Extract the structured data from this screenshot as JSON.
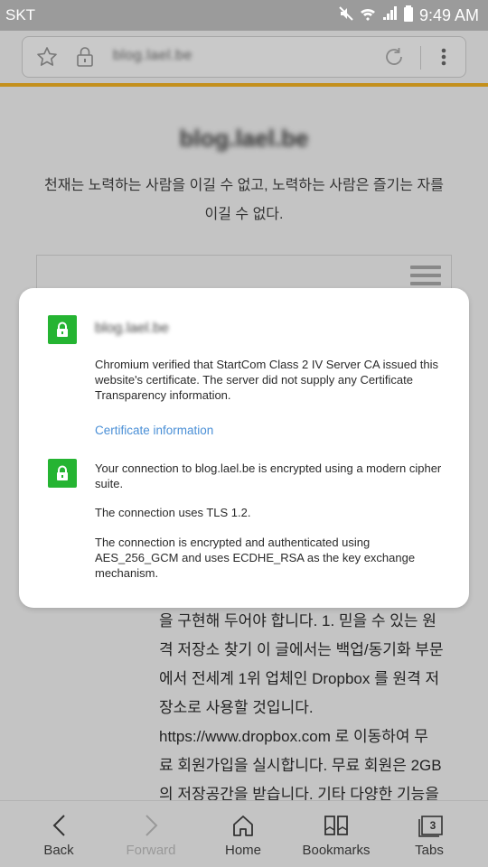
{
  "status_bar": {
    "carrier": "SKT",
    "time": "9:49 AM"
  },
  "address_bar": {
    "url": "blog.lael.be"
  },
  "page": {
    "title": "blog.lael.be",
    "tagline_line1": "천재는 노력하는 사람을 이길 수 없고, 노력하는 사람은 즐기는 자를",
    "tagline_line2": "이길 수 없다.",
    "body_lines": [
      "을 구현해 두어야 합니다.   1. 믿을 수 있는 원",
      "격 저장소 찾기 이 글에서는 백업/동기화 부문",
      "에서 전세계 1위 업체인 Dropbox 를 원격 저",
      "장소로 사용할 것입니다.",
      "https://www.dropbox.com 로 이동하여 무",
      "료 회원가입을 실시합니다. 무료 회원은 2GB",
      "의 저장공간을 받습니다. 기타 다양한 기능을"
    ]
  },
  "dialog": {
    "host": "blog.lael.be",
    "cert_text": "Chromium verified that StartCom Class 2 IV Server CA issued this website's certificate. The server did not supply any Certificate Transparency information.",
    "cert_link": "Certificate information",
    "conn_text": "Your connection to blog.lael.be is encrypted using a modern cipher suite.",
    "tls_text": "The connection uses TLS 1.2.",
    "cipher_text": "The connection is encrypted and authenticated using AES_256_GCM and uses ECDHE_RSA as the key exchange mechanism."
  },
  "bottom_nav": {
    "back": "Back",
    "forward": "Forward",
    "home": "Home",
    "bookmarks": "Bookmarks",
    "tabs": "Tabs",
    "tab_count": "3"
  },
  "colors": {
    "accent_line": "#c4901c",
    "secure_green": "#25b432",
    "link_blue": "#4a8fd6"
  }
}
